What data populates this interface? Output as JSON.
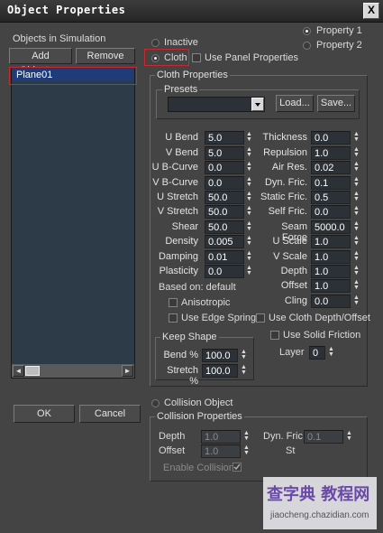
{
  "window": {
    "title": "Object Properties",
    "close_label": "X"
  },
  "left_panel": {
    "group_label": "Objects in Simulation",
    "add_objects_label": "Add Objects...",
    "remove_label": "Remove",
    "list_items": [
      "Plane01"
    ],
    "scroll_left": "◄",
    "scroll_right": "►",
    "ok_label": "OK",
    "cancel_label": "Cancel"
  },
  "mode": {
    "property1_label": "Property 1",
    "property2_label": "Property 2",
    "inactive_label": "Inactive",
    "cloth_label": "Cloth",
    "use_panel_label": "Use Panel Properties",
    "selected": "Cloth",
    "selected_property": "Property 1"
  },
  "cloth_properties": {
    "group_label": "Cloth Properties",
    "presets_label": "Presets",
    "preset_value": "",
    "load_label": "Load...",
    "save_label": "Save...",
    "left_fields": [
      {
        "label": "U Bend",
        "value": "5.0"
      },
      {
        "label": "V Bend",
        "value": "5.0"
      },
      {
        "label": "U B-Curve",
        "value": "0.0"
      },
      {
        "label": "V B-Curve",
        "value": "0.0"
      },
      {
        "label": "U Stretch",
        "value": "50.0"
      },
      {
        "label": "V Stretch",
        "value": "50.0"
      },
      {
        "label": "Shear",
        "value": "50.0"
      },
      {
        "label": "Density",
        "value": "0.005"
      },
      {
        "label": "Damping",
        "value": "0.01"
      },
      {
        "label": "Plasticity",
        "value": "0.0"
      }
    ],
    "right_fields": [
      {
        "label": "Thickness",
        "value": "0.0"
      },
      {
        "label": "Repulsion",
        "value": "1.0"
      },
      {
        "label": "Air Res.",
        "value": "0.02"
      },
      {
        "label": "Dyn. Fric.",
        "value": "0.1"
      },
      {
        "label": "Static Fric.",
        "value": "0.5"
      },
      {
        "label": "Self Fric.",
        "value": "0.0"
      },
      {
        "label": "Seam Force",
        "value": "5000.0"
      },
      {
        "label": "U Scale",
        "value": "1.0"
      },
      {
        "label": "V Scale",
        "value": "1.0"
      },
      {
        "label": "Depth",
        "value": "1.0"
      },
      {
        "label": "Offset",
        "value": "1.0"
      },
      {
        "label": "Cling",
        "value": "0.0"
      }
    ],
    "based_on_label": "Based on: default",
    "anisotropic_label": "Anisotropic",
    "use_edge_springs_label": "Use Edge Springs",
    "use_cloth_depth_label": "Use Cloth Depth/Offset",
    "keep_shape_label": "Keep Shape",
    "bend_label": "Bend %",
    "bend_value": "100.0",
    "stretch_label": "Stretch %",
    "stretch_value": "100.0",
    "use_solid_friction_label": "Use Solid Friction",
    "layer_label": "Layer",
    "layer_value": "0"
  },
  "collision": {
    "radio_label": "Collision Object",
    "group_label": "Collision Properties",
    "depth_label": "Depth",
    "depth_value": "1.0",
    "offset_label": "Offset",
    "offset_value": "1.0",
    "dyn_fric_label": "Dyn. Fric.",
    "dyn_fric_value": "0.1",
    "stat_label": "St",
    "enable_collisions_label": "Enable Collisions"
  },
  "watermark": {
    "line1": "查字典 教程网",
    "line2": "jiaocheng.chazidian.com"
  }
}
